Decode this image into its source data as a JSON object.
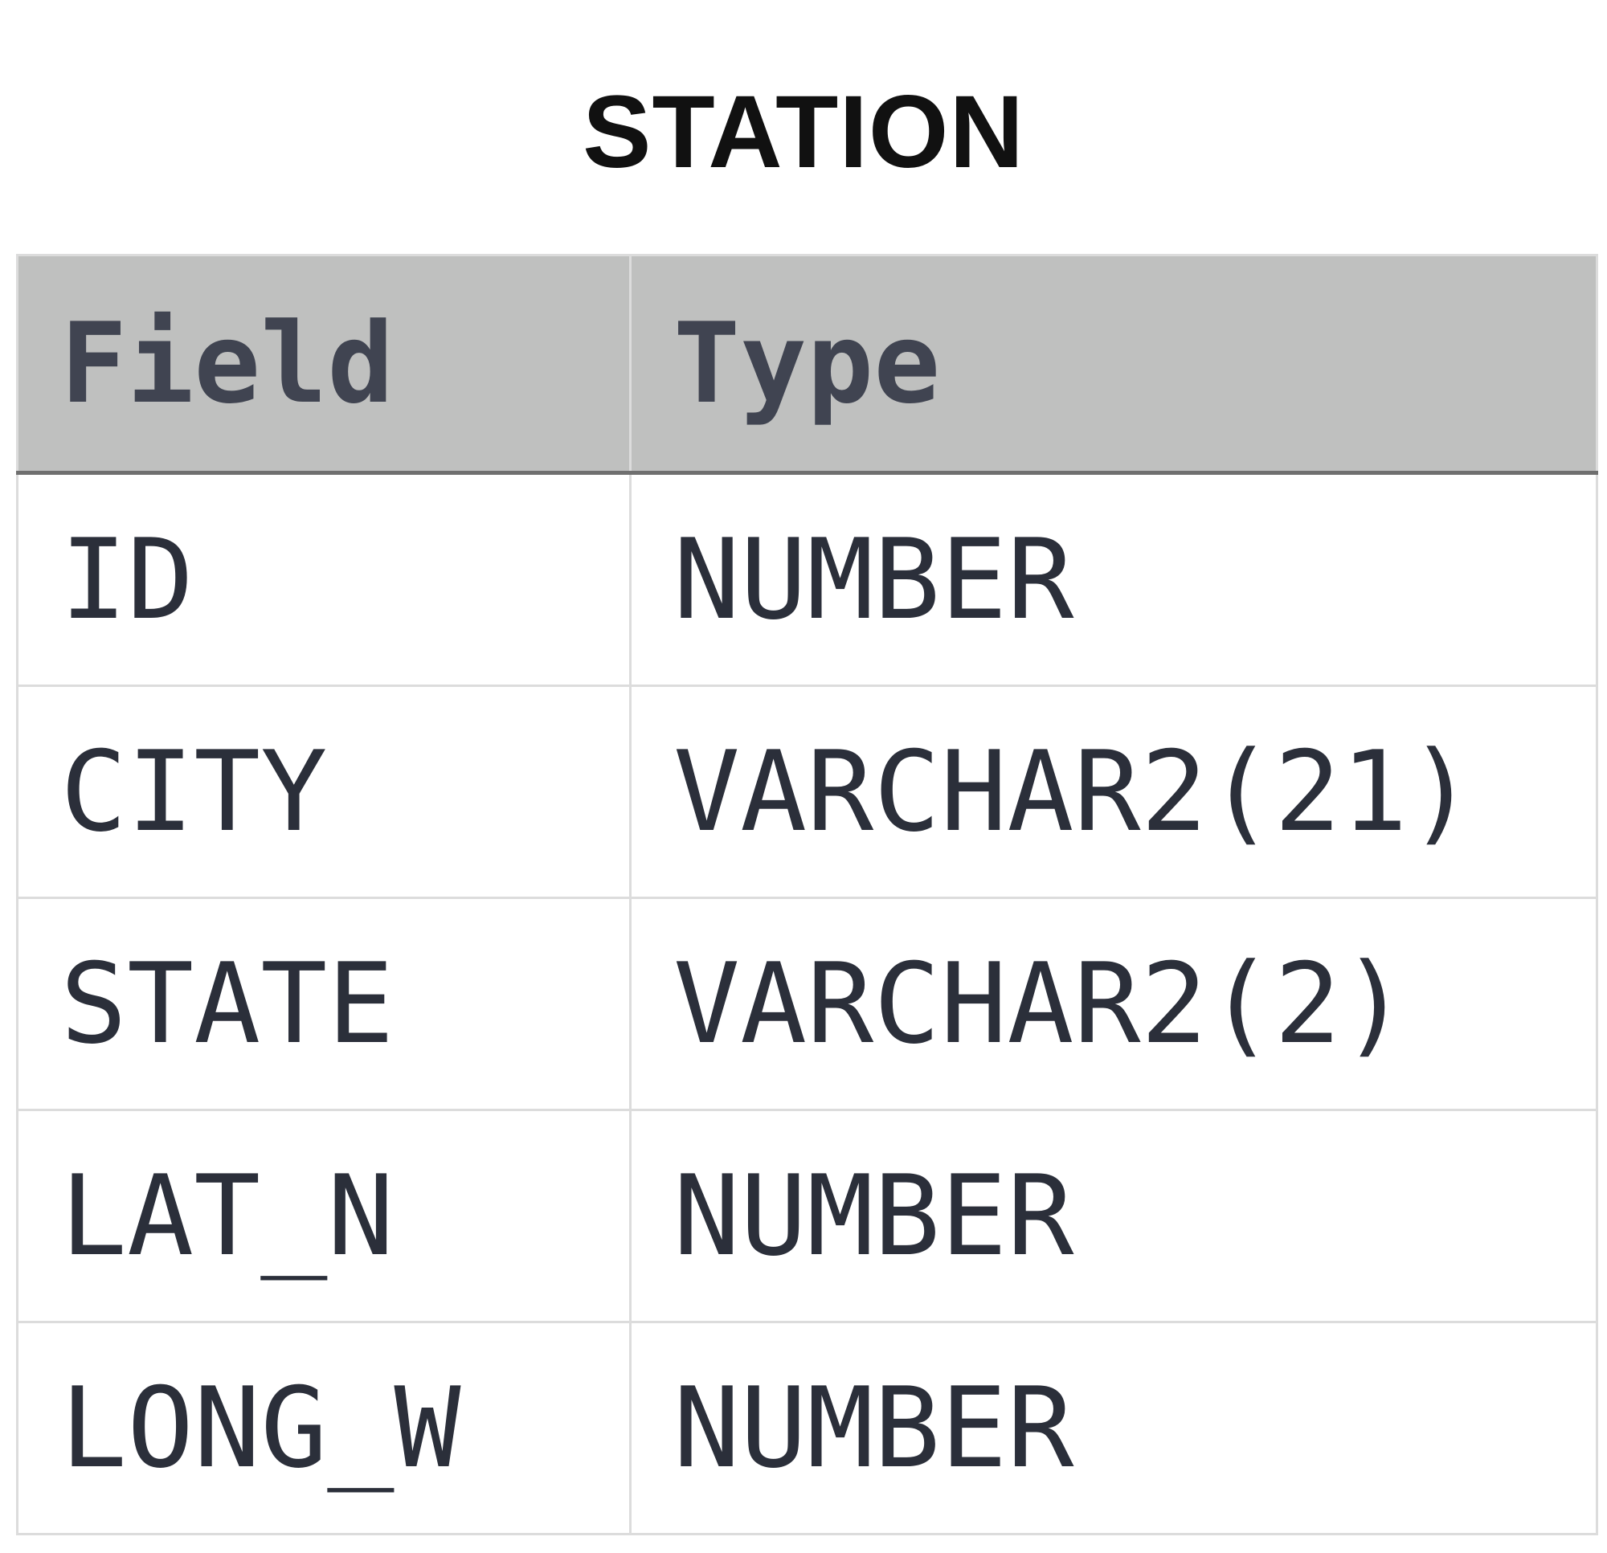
{
  "table": {
    "title": "STATION",
    "headers": [
      "Field",
      "Type"
    ],
    "rows": [
      [
        "ID",
        "NUMBER"
      ],
      [
        "CITY",
        "VARCHAR2(21)"
      ],
      [
        "STATE",
        "VARCHAR2(2)"
      ],
      [
        "LAT_N",
        "NUMBER"
      ],
      [
        "LONG_W",
        "NUMBER"
      ]
    ]
  }
}
